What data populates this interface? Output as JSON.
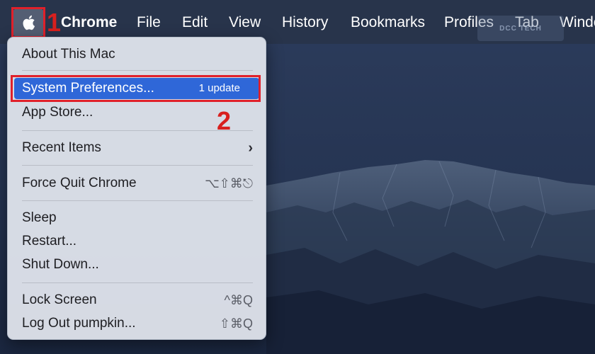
{
  "menubar": {
    "app_name": "Chrome",
    "items": [
      "File",
      "Edit",
      "View",
      "History",
      "Bookmarks",
      "Profiles",
      "Tab",
      "Windo"
    ],
    "watermark": "DCC TECH"
  },
  "apple_menu": {
    "about": "About This Mac",
    "system_preferences": "System Preferences...",
    "system_preferences_badge": "1 update",
    "app_store": "App Store...",
    "recent_items": "Recent Items",
    "force_quit": "Force Quit Chrome",
    "force_quit_shortcut": "⌥⇧⌘⎋",
    "sleep": "Sleep",
    "restart": "Restart...",
    "shut_down": "Shut Down...",
    "lock_screen": "Lock Screen",
    "lock_screen_shortcut": "^⌘Q",
    "log_out": "Log Out pumpkin...",
    "log_out_shortcut": "⇧⌘Q"
  },
  "annotations": {
    "step1": "1",
    "step2": "2",
    "color": "#e0202a"
  },
  "colors": {
    "highlight": "#2f67d8",
    "menubar_text": "#ffffff"
  }
}
